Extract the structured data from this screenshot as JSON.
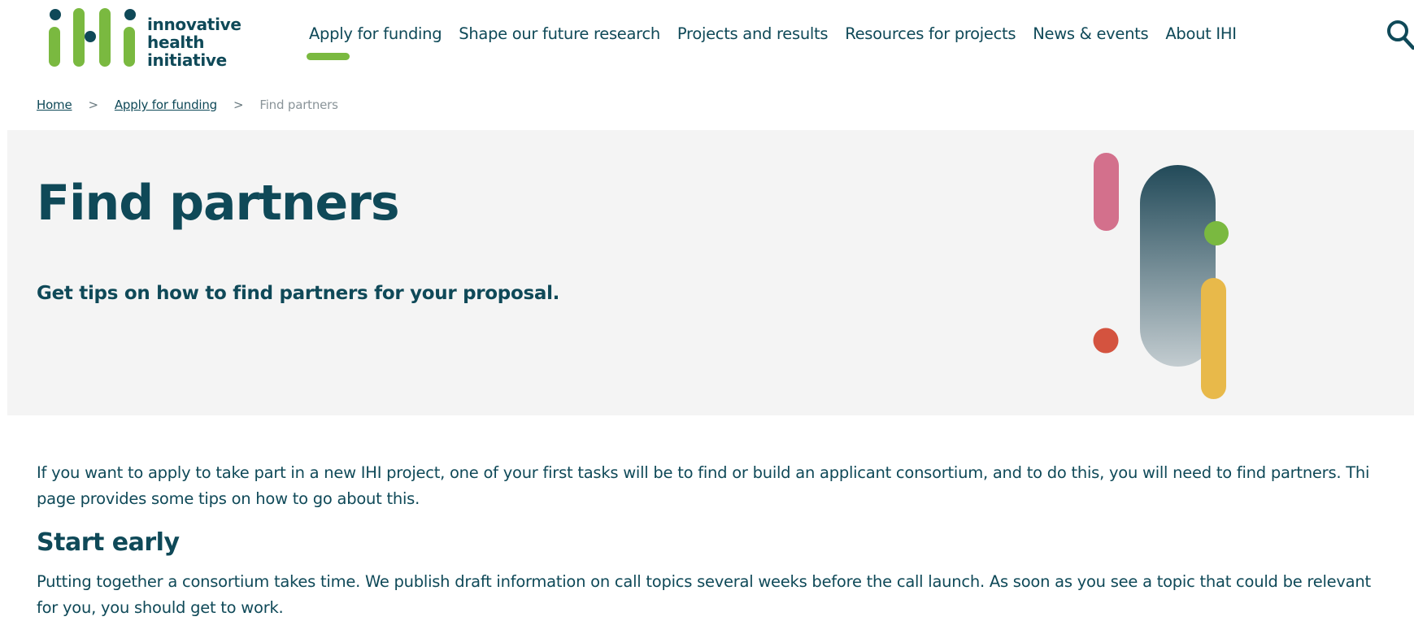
{
  "logo": {
    "line1": "innovative",
    "line2": "health",
    "line3": "initiative"
  },
  "nav": {
    "items": [
      {
        "label": "Apply for funding"
      },
      {
        "label": "Shape our future research"
      },
      {
        "label": "Projects and results"
      },
      {
        "label": "Resources for projects"
      },
      {
        "label": "News & events"
      },
      {
        "label": "About IHI"
      }
    ],
    "active_index": 0
  },
  "search": {
    "icon": "search-icon"
  },
  "breadcrumb": {
    "home": "Home",
    "parent": "Apply for funding",
    "current": "Find partners",
    "separator": ">"
  },
  "hero": {
    "title": "Find partners",
    "subtitle": "Get tips on how to find partners for your proposal."
  },
  "content": {
    "intro_line1": "If you want to apply to take part in a new IHI project, one of your first tasks will be to find or build an applicant consortium, and to do this, you will need to find partners. Thi",
    "intro_line2": "page provides some tips on how to go about this.",
    "section_heading": "Start early",
    "section_line1": "Putting together a consortium takes time. We publish draft information on call topics several weeks before the call launch. As soon as you see a topic that could be relevant",
    "section_line2": "for you, you should get to work."
  },
  "colors": {
    "brand_teal": "#0f4958",
    "brand_green": "#7ab940",
    "hero_bg": "#f4f4f4",
    "accent_pink": "#d3708c",
    "accent_red": "#d4533f",
    "accent_yellow": "#e8b94a"
  }
}
